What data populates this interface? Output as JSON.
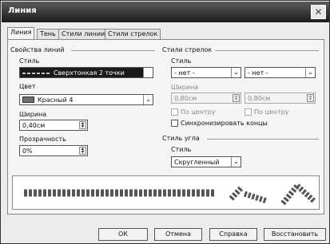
{
  "window": {
    "title": "Линия",
    "close_glyph": "✕"
  },
  "tabs": [
    {
      "label": "Линия",
      "active": true
    },
    {
      "label": "Тень",
      "active": false
    },
    {
      "label": "Стили линии",
      "active": false
    },
    {
      "label": "Стили стрелок",
      "active": false
    }
  ],
  "line_props": {
    "section": "Свойства линий",
    "style_label": "Стиль",
    "style_value": "Сверхтонкая 2 точки",
    "color_label": "Цвет",
    "color_value": "Красный 4",
    "color_swatch": "#6e6e6e",
    "width_label": "Ширина",
    "width_value": "0,40см",
    "transparency_label": "Прозрачность",
    "transparency_value": "0%"
  },
  "arrow_styles": {
    "section": "Стили стрелок",
    "style_label": "Стиль",
    "start_value": "- нет -",
    "end_value": "- нет -",
    "width_label": "Ширина",
    "start_width": "0,80см",
    "end_width": "0,80см",
    "center_start_label": "По центру",
    "center_end_label": "По центру",
    "sync_label": "Синхронизировать концы"
  },
  "corner_style": {
    "section": "Стиль угла",
    "style_label": "Стиль",
    "style_value": "Скругленный"
  },
  "buttons": {
    "ok": "ОК",
    "cancel": "Отмена",
    "help": "Справка",
    "reset": "Восстановить"
  }
}
